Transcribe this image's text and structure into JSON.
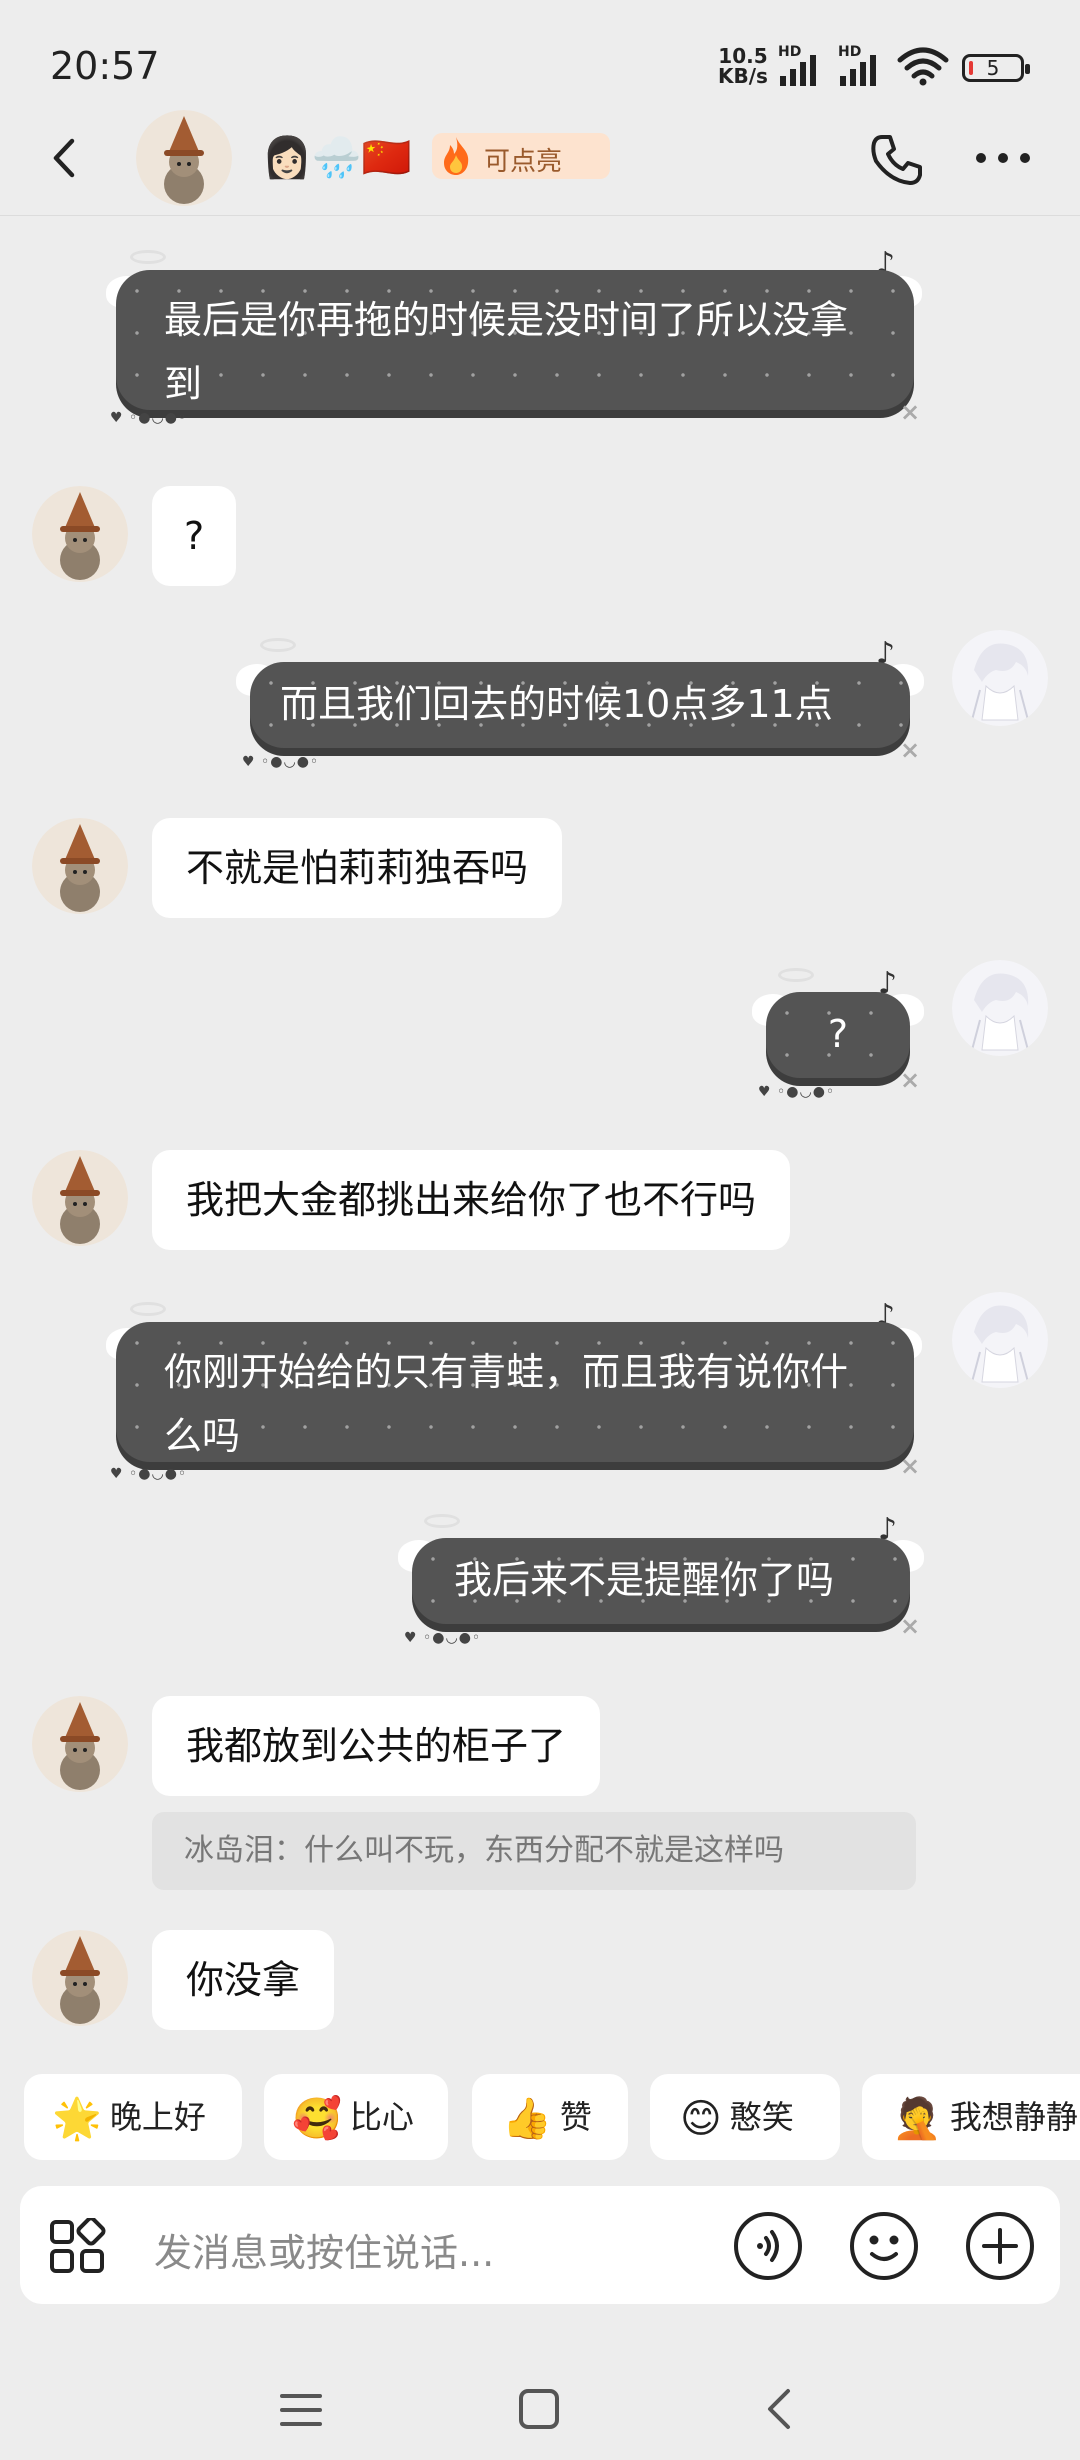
{
  "status_bar": {
    "time": "20:57",
    "net_speed_value": "10.5",
    "net_speed_unit": "KB/s",
    "signal_label": "HD",
    "battery": "5"
  },
  "header": {
    "emojis": "👩🏻🌧️🇨🇳",
    "light_up_label": "可点亮"
  },
  "messages": [
    {
      "side": "right",
      "text": "最后是你再拖的时候是没时间了所以没拿到"
    },
    {
      "side": "left",
      "text": "?"
    },
    {
      "side": "right",
      "text": "而且我们回去的时候10点多11点"
    },
    {
      "side": "left",
      "text": "不就是怕莉莉独吞吗"
    },
    {
      "side": "right",
      "text": "?"
    },
    {
      "side": "left",
      "text": "我把大金都挑出来给你了也不行吗"
    },
    {
      "side": "right",
      "text": "你刚开始给的只有青蛙，而且我有说你什么吗"
    },
    {
      "side": "right",
      "text": "我后来不是提醒你了吗"
    },
    {
      "side": "left",
      "text": "我都放到公共的柜子了"
    },
    {
      "side": "left",
      "text": "你没拿"
    }
  ],
  "quote": "冰岛泪：什么叫不玩，东西分配不就是这样吗",
  "quick_replies": [
    {
      "emoji": "🌟",
      "label": "晚上好"
    },
    {
      "emoji": "🥰",
      "label": "比心"
    },
    {
      "emoji": "👍",
      "label": "赞"
    },
    {
      "emoji": "😊",
      "label": "憨笑"
    },
    {
      "emoji": "🤦",
      "label": "我想静静"
    }
  ],
  "input": {
    "placeholder": "发消息或按住说话..."
  },
  "colors": {
    "background": "#ededed",
    "dark_bubble": "#545454",
    "light_up_bg": "#fde3cf"
  },
  "icons": [
    "back-icon",
    "phone-icon",
    "more-icon",
    "apps-icon",
    "voice-icon",
    "emoji-icon",
    "plus-icon",
    "menu-nav-icon",
    "home-nav-icon",
    "back-nav-icon"
  ]
}
